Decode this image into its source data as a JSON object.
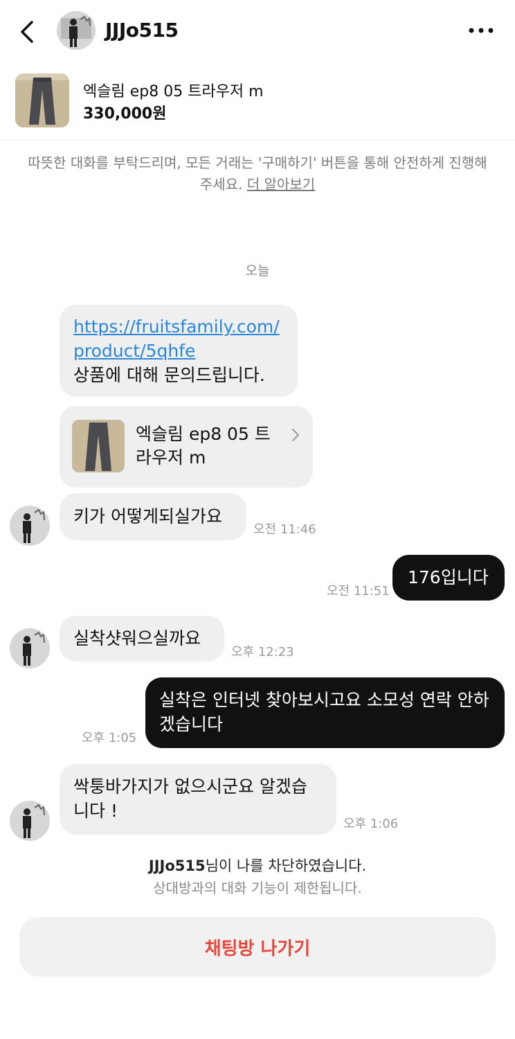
{
  "header": {
    "username": "JJJo515",
    "back_icon": "chevron-left-icon",
    "more_icon": "more-horizontal-icon"
  },
  "product": {
    "title": "엑슬림 ep8 05 트라우저 m",
    "price": "330,000원"
  },
  "notice": {
    "text": "따뜻한 대화를 부탁드리며, 모든 거래는 '구매하기' 버튼을 통해 안전하게 진행해 주세요.",
    "link": "더 알아보기"
  },
  "date_separator": "오늘",
  "messages": {
    "m1_link": "https://fruitsfamily.com/product/5qhfe",
    "m1_text": "상품에 대해 문의드립니다.",
    "m2_card_title": "엑슬림 ep8 05 트라우저 m",
    "m3_text": "키가 어떻게되실가요",
    "m3_time": "오전 11:46",
    "m4_text": "176입니다",
    "m4_time": "오전 11:51",
    "m5_text": "실착샷워으실까요",
    "m5_time": "오후 12:23",
    "m6_text": "실착은 인터넷 찾아보시고요 소모성 연락 안하겠습니다",
    "m6_time": "오후 1:05",
    "m7_text": "싹퉁바가지가 없으시군요 알겠습니다 !",
    "m7_time": "오후 1:06"
  },
  "blocked": {
    "username": "JJJo515",
    "suffix": "님이 나를 차단하였습니다.",
    "subtext": "상대방과의 대화 기능이 제한됩니다."
  },
  "leave_button": "채팅방 나가기",
  "colors": {
    "link": "#2a86d8",
    "danger": "#e5483b",
    "bubble_in": "#efefef",
    "bubble_out": "#111111"
  }
}
